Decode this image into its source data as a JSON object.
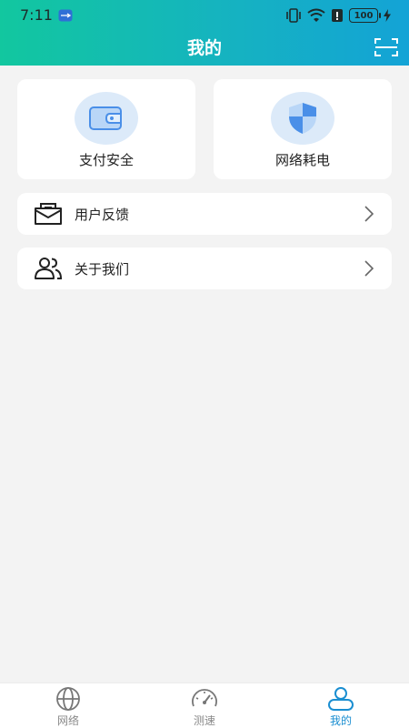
{
  "status_bar": {
    "time": "7:11",
    "battery": "100"
  },
  "header": {
    "title": "我的"
  },
  "cards": [
    {
      "label": "支付安全",
      "icon": "wallet-icon"
    },
    {
      "label": "网络耗电",
      "icon": "shield-icon"
    }
  ],
  "menu": [
    {
      "label": "用户反馈",
      "icon": "mail-icon"
    },
    {
      "label": "关于我们",
      "icon": "users-icon"
    }
  ],
  "tabs": [
    {
      "label": "网络",
      "icon": "globe-icon",
      "active": false
    },
    {
      "label": "测速",
      "icon": "speedometer-icon",
      "active": false
    },
    {
      "label": "我的",
      "icon": "user-icon",
      "active": true
    }
  ],
  "colors": {
    "header_start": "#12c79f",
    "header_end": "#14a3d6",
    "active_tab": "#1a8ed1",
    "icon_blue": "#4a8fe8"
  }
}
